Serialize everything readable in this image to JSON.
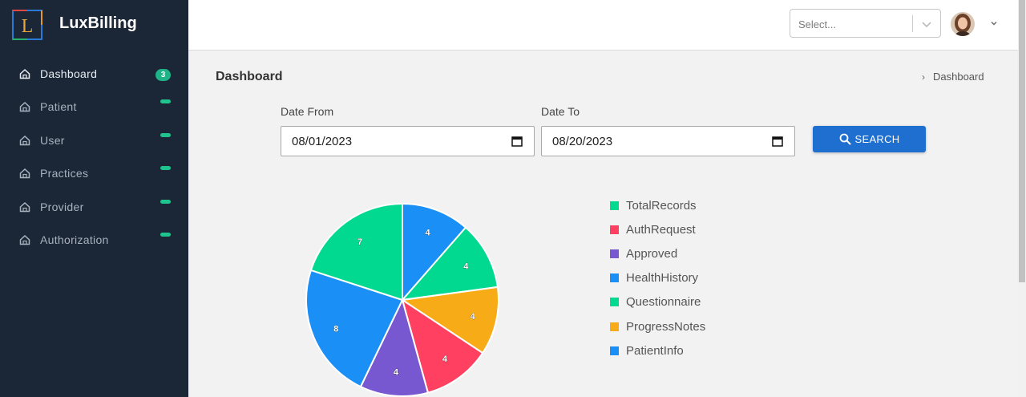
{
  "app": {
    "name": "LuxBilling",
    "logo_letter": "L"
  },
  "sidebar": {
    "items": [
      {
        "label": "Dashboard",
        "badge": "3",
        "active": true
      },
      {
        "label": "Patient"
      },
      {
        "label": "User"
      },
      {
        "label": "Practices"
      },
      {
        "label": "Provider"
      },
      {
        "label": "Authorization"
      }
    ]
  },
  "header": {
    "select_placeholder": "Select..."
  },
  "page": {
    "title": "Dashboard",
    "breadcrumb": "Dashboard"
  },
  "filters": {
    "date_from_label": "Date From",
    "date_from_value": "08/01/2023",
    "date_to_label": "Date To",
    "date_to_value": "08/20/2023",
    "search_label": "SEARCH"
  },
  "colors": {
    "sidebar_bg": "#1b2737",
    "accent_blue": "#1e6fcf",
    "badge_green": "#1fb487"
  },
  "chart_data": {
    "type": "pie",
    "slices": [
      {
        "name": "HealthHistory",
        "value": 4,
        "color": "#1a8ff5"
      },
      {
        "name": "Questionnaire",
        "value": 4,
        "color": "#00d98f"
      },
      {
        "name": "ProgressNotes",
        "value": 4,
        "color": "#f7ab16"
      },
      {
        "name": "AuthRequest",
        "value": 4,
        "color": "#ff4060"
      },
      {
        "name": "Approved",
        "value": 4,
        "color": "#7858d0"
      },
      {
        "name": "PatientInfo",
        "value": 8,
        "color": "#1a8ff5"
      },
      {
        "name": "TotalRecords",
        "value": 7,
        "color": "#00d98f"
      }
    ],
    "legend": [
      {
        "name": "TotalRecords",
        "color": "#00d98f"
      },
      {
        "name": "AuthRequest",
        "color": "#ff4060"
      },
      {
        "name": "Approved",
        "color": "#7858d0"
      },
      {
        "name": "HealthHistory",
        "color": "#1a8ff5"
      },
      {
        "name": "Questionnaire",
        "color": "#00d98f"
      },
      {
        "name": "ProgressNotes",
        "color": "#f7ab16"
      },
      {
        "name": "PatientInfo",
        "color": "#1a8ff5"
      }
    ]
  }
}
